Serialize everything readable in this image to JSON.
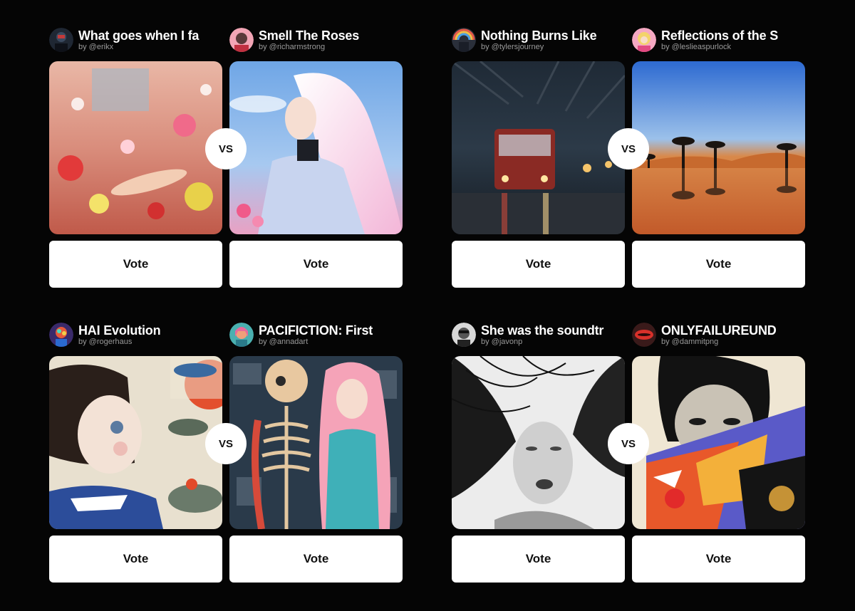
{
  "vote_label": "Vote",
  "vs_label": "VS",
  "matchups": [
    {
      "left": {
        "title": "What goes when I fa",
        "author": "by @erikx",
        "avatar_icon": "dark-avatar-icon",
        "image": "flower-room-image"
      },
      "right": {
        "title": "Smell The Roses",
        "author": "by @richarmstrong",
        "avatar_icon": "pink-avatar-icon",
        "image": "white-haired-woman-sky-image"
      }
    },
    {
      "left": {
        "title": "Nothing Burns Like",
        "author": "by @tylersjourney",
        "avatar_icon": "rainbow-avatar-icon",
        "image": "rainy-streetcar-night-image"
      },
      "right": {
        "title": "Reflections of the S",
        "author": "by @leslieaspurlock",
        "avatar_icon": "blonde-avatar-icon",
        "image": "desert-palms-reflection-image"
      }
    },
    {
      "left": {
        "title": "HAI Evolution",
        "author": "by @rogerhaus",
        "avatar_icon": "colorful-avatar-icon",
        "image": "girl-with-lizards-image"
      },
      "right": {
        "title": "PACIFICTION: First",
        "author": "by @annadart",
        "avatar_icon": "teal-avatar-icon",
        "image": "skeleton-and-pink-haired-woman-image"
      }
    },
    {
      "left": {
        "title": "She was the soundtr",
        "author": "by @javonp",
        "avatar_icon": "grayscale-avatar-icon",
        "image": "black-and-white-woman-hair-image"
      },
      "right": {
        "title": "ONLYFAILUREUND",
        "author": "by @dammitpng",
        "avatar_icon": "lips-avatar-icon",
        "image": "collage-face-mask-image"
      }
    }
  ]
}
